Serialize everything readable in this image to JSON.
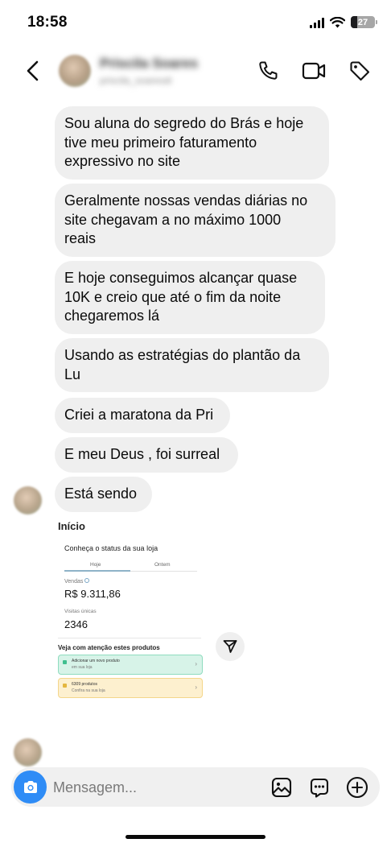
{
  "status_bar": {
    "time": "18:58",
    "battery": "27",
    "battery_fraction": 0.27,
    "icons": [
      "signal-icon",
      "wifi-icon",
      "battery-icon"
    ]
  },
  "header": {
    "contact_name": "Priscila Soares",
    "contact_username": "priscila_soaresdi",
    "icons": [
      "back-icon",
      "phone-icon",
      "video-icon",
      "tag-icon"
    ]
  },
  "messages": [
    {
      "text": "Sou aluna do segredo do Brás e hoje\ntive meu primeiro faturamento\nexpressivo no site"
    },
    {
      "text": "Geralmente nossas vendas diárias no\nsite chegavam a no máximo 1000\nreais"
    },
    {
      "text": "E hoje conseguimos alcançar quase\n10K e creio que até o fim da noite\nchegaremos lá"
    },
    {
      "text": "Usando as estratégias do plantão da\nLu"
    },
    {
      "text": "Criei a maratona da Pri"
    },
    {
      "text": "E meu Deus , foi surreal"
    },
    {
      "text": "Está sendo"
    }
  ],
  "shared_image": {
    "heading": "Início",
    "status_title": "Conheça o status da sua loja",
    "tabs": [
      "Hoje",
      "Ontem"
    ],
    "sales_label": "Vendas",
    "sales_value": "R$ 9.311,86",
    "visits_label": "Visitas únicas",
    "visits_value": "2346",
    "products_heading": "Veja com atenção estes produtos",
    "card1_line1": "Adicionar um novo produto",
    "card1_line2": "em sua loja",
    "card2_line1": "6309 produtos",
    "card2_line2": "Confira na sua loja"
  },
  "composer": {
    "placeholder": "Mensagem...",
    "value": "",
    "icons": [
      "camera-icon",
      "gallery-icon",
      "sticker-icon",
      "plus-icon"
    ]
  },
  "colors": {
    "bubble": "#efefef",
    "camera_button": "#2f8cf6",
    "composer_bg": "#f0f0f0"
  }
}
